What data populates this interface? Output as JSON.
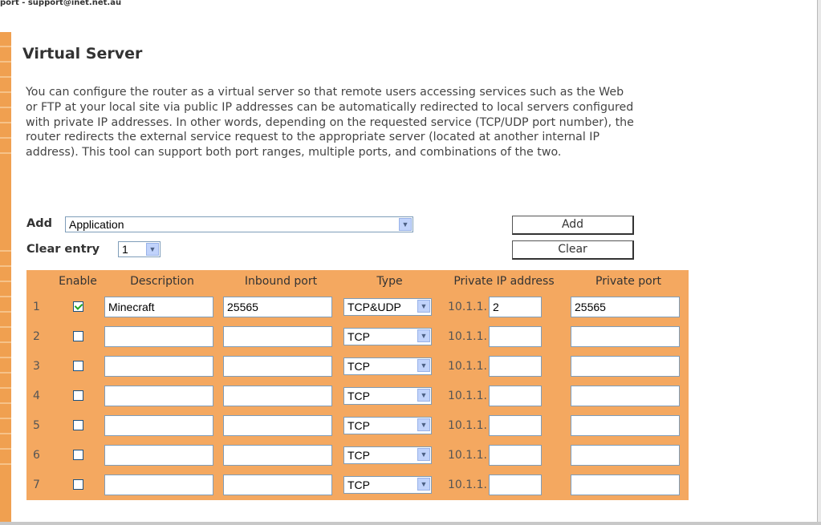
{
  "topbar": {
    "text": "port - support@inet.net.au"
  },
  "page": {
    "title": "Virtual Server",
    "description": "You can configure the router as a virtual server so that remote users accessing services such as the Web or FTP at your local site via public IP addresses can be automatically redirected to local servers configured with private IP addresses. In other words, depending on the requested service (TCP/UDP port number), the router redirects the external service request to the appropriate server (located at another internal IP address). This tool can support both port ranges, multiple ports, and combinations of the two."
  },
  "add": {
    "label": "Add",
    "selected": "Application",
    "button": "Add"
  },
  "clear": {
    "label": "Clear entry",
    "selected": "1",
    "button": "Clear"
  },
  "table": {
    "headers": [
      "Enable",
      "Description",
      "Inbound port",
      "Type",
      "Private IP address",
      "Private port"
    ],
    "ip_prefix": "10.1.1.",
    "rows": [
      {
        "num": "1",
        "enabled": true,
        "description": "Minecraft",
        "inbound": "25565",
        "type": "TCP&UDP",
        "ip": "2",
        "private_port": "25565"
      },
      {
        "num": "2",
        "enabled": false,
        "description": "",
        "inbound": "",
        "type": "TCP",
        "ip": "",
        "private_port": ""
      },
      {
        "num": "3",
        "enabled": false,
        "description": "",
        "inbound": "",
        "type": "TCP",
        "ip": "",
        "private_port": ""
      },
      {
        "num": "4",
        "enabled": false,
        "description": "",
        "inbound": "",
        "type": "TCP",
        "ip": "",
        "private_port": ""
      },
      {
        "num": "5",
        "enabled": false,
        "description": "",
        "inbound": "",
        "type": "TCP",
        "ip": "",
        "private_port": ""
      },
      {
        "num": "6",
        "enabled": false,
        "description": "",
        "inbound": "",
        "type": "TCP",
        "ip": "",
        "private_port": ""
      },
      {
        "num": "7",
        "enabled": false,
        "description": "",
        "inbound": "",
        "type": "TCP",
        "ip": "",
        "private_port": ""
      }
    ]
  },
  "colors": {
    "accent": "#f4a860",
    "stripe": "#f0a050"
  },
  "icons": {
    "dropdown": "chevron-down-icon",
    "checkbox": "check-icon"
  }
}
